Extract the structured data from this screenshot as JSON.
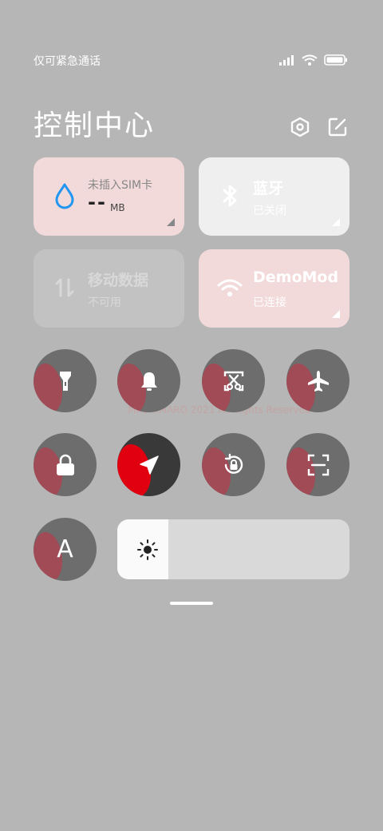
{
  "status_bar": {
    "text": "仅可紧急通话"
  },
  "header": {
    "title": "控制中心"
  },
  "tiles": {
    "data": {
      "title": "未插入SIM卡",
      "value": "--",
      "unit": "MB",
      "icon": "water-drop-icon"
    },
    "bluetooth": {
      "title": "蓝牙",
      "subtitle": "已关闭",
      "icon": "bluetooth-icon"
    },
    "mobile": {
      "title": "移动数据",
      "subtitle": "不可用",
      "icon": "arrows-updown-icon"
    },
    "wifi": {
      "title": "DemoMod",
      "subtitle": "已连接",
      "icon": "wifi-icon"
    }
  },
  "toggles": [
    {
      "name": "flashlight",
      "icon": "flashlight-icon"
    },
    {
      "name": "notifications",
      "icon": "bell-icon"
    },
    {
      "name": "screenshot",
      "icon": "scissors-icon"
    },
    {
      "name": "airplane-mode",
      "icon": "airplane-icon"
    },
    {
      "name": "lock-screen",
      "icon": "lock-icon"
    },
    {
      "name": "location",
      "icon": "location-arrow-icon",
      "active": true
    },
    {
      "name": "rotation-lock",
      "icon": "rotation-lock-icon"
    },
    {
      "name": "scan",
      "icon": "scan-icon"
    },
    {
      "name": "font-size",
      "icon": "letter-a-icon",
      "label": "A"
    }
  ],
  "brightness": {
    "icon": "sun-icon",
    "level": 0.22
  },
  "watermark": {
    "text": "MXSHIMARO 2021 All Rights Reserved"
  },
  "colors": {
    "accent_red": "#e0000f",
    "tile_pink": "#f2d9da",
    "background": "#b6b6b6",
    "blue_icon": "#2196f3"
  }
}
